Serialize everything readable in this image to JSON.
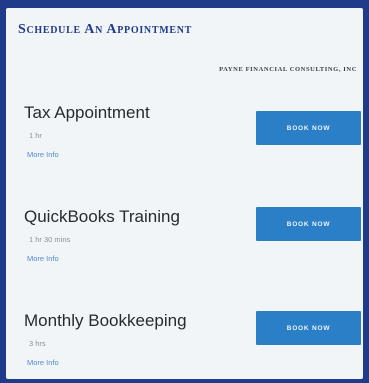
{
  "header": {
    "title": "Schedule An Appointment",
    "company": "PAYNE FINANCIAL CONSULTING, INC"
  },
  "services": [
    {
      "name": "Tax Appointment",
      "duration": "1 hr",
      "more_info": "More Info",
      "book_label": "BOOK NOW"
    },
    {
      "name": "QuickBooks Training",
      "duration": "1 hr 30 mins",
      "more_info": "More Info",
      "book_label": "BOOK NOW"
    },
    {
      "name": "Monthly Bookkeeping",
      "duration": "3 hrs",
      "more_info": "More Info",
      "book_label": "BOOK NOW"
    }
  ],
  "colors": {
    "frame": "#1f3b8a",
    "panel": "#f2f5f7",
    "button": "#2a7fc6",
    "link": "#4f8cc9",
    "title": "#1f3b8a"
  }
}
